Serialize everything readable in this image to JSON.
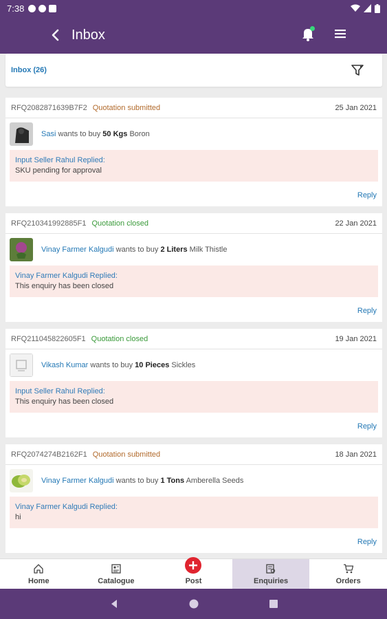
{
  "status_bar": {
    "time": "7:38"
  },
  "app_bar": {
    "title": "Inbox"
  },
  "inbox": {
    "count_label": "Inbox (26)"
  },
  "enquiries": [
    {
      "rfq": "RFQ2082871639B7F2",
      "status": "Quotation submitted",
      "status_type": "submitted",
      "date": "25 Jan 2021",
      "buyer": "Sasi",
      "wants": "wants to buy",
      "quantity": "50 Kgs",
      "product": "Boron",
      "replier": "Input Seller Rahul Replied:",
      "reply": "SKU pending for approval",
      "reply_link": "Reply",
      "thumb": "boron-product"
    },
    {
      "rfq": "RFQ210341992885F1",
      "status": "Quotation closed",
      "status_type": "closed",
      "date": "22 Jan 2021",
      "buyer": "Vinay Farmer Kalgudi",
      "wants": "wants to buy",
      "quantity": "2 Liters",
      "product": "Milk Thistle",
      "replier": "Vinay Farmer Kalgudi Replied:",
      "reply": "This enquiry has been closed",
      "reply_link": "Reply",
      "thumb": "thistle-flower"
    },
    {
      "rfq": "RFQ211045822605F1",
      "status": "Quotation closed",
      "status_type": "closed",
      "date": "19 Jan 2021",
      "buyer": "Vikash Kumar",
      "wants": "wants to buy",
      "quantity": "10 Pieces",
      "product": "Sickles",
      "replier": "Input Seller Rahul Replied:",
      "reply": "This enquiry has been closed",
      "reply_link": "Reply",
      "thumb": "placeholder-image"
    },
    {
      "rfq": "RFQ2074274B2162F1",
      "status": "Quotation submitted",
      "status_type": "submitted",
      "date": "18 Jan 2021",
      "buyer": "Vinay Farmer Kalgudi",
      "wants": "wants to buy",
      "quantity": "1 Tons",
      "product": "Amberella Seeds",
      "replier": "Vinay Farmer Kalgudi Replied:",
      "reply": "hi",
      "reply_link": "Reply",
      "thumb": "amberella-fruit"
    }
  ],
  "bottom_nav": {
    "items": [
      {
        "label": "Home",
        "icon": "home-icon"
      },
      {
        "label": "Catalogue",
        "icon": "catalogue-icon"
      },
      {
        "label": "Post",
        "icon": "plus-icon"
      },
      {
        "label": "Enquiries",
        "icon": "enquiries-icon",
        "active": true
      },
      {
        "label": "Orders",
        "icon": "cart-icon"
      }
    ]
  },
  "colors": {
    "primary": "#5b3a78",
    "link": "#2378b5",
    "submitted": "#b26b2d",
    "closed": "#3a9a3a",
    "reply_bg": "#fbe9e6",
    "post": "#e0242f"
  }
}
